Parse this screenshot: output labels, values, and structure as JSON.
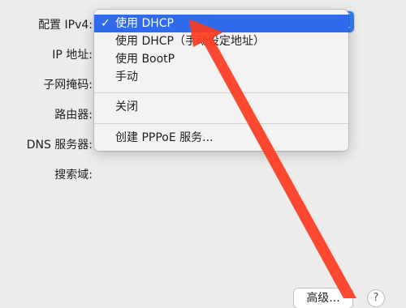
{
  "form": {
    "labels": {
      "configure_ipv4": "配置 IPv4:",
      "ip_address": "IP 地址:",
      "subnet_mask": "子网掩码:",
      "router": "路由器:",
      "dns_servers": "DNS 服务器:",
      "search_domains": "搜索域:"
    }
  },
  "popup": {
    "stepper_glyph": "⌃\n⌄",
    "checkmark": "✓",
    "items": [
      {
        "label": "使用 DHCP",
        "selected": true
      },
      {
        "label": "使用 DHCP（手动设定地址）"
      },
      {
        "label": "使用 BootP"
      },
      {
        "label": "手动"
      },
      {
        "label": "关闭"
      },
      {
        "label": "创建 PPPoE 服务..."
      }
    ]
  },
  "footer": {
    "advanced_label": "高级...",
    "help_label": "?"
  },
  "colors": {
    "selection": "#2f6bea",
    "annotation_arrow": "#ff3b1f"
  }
}
